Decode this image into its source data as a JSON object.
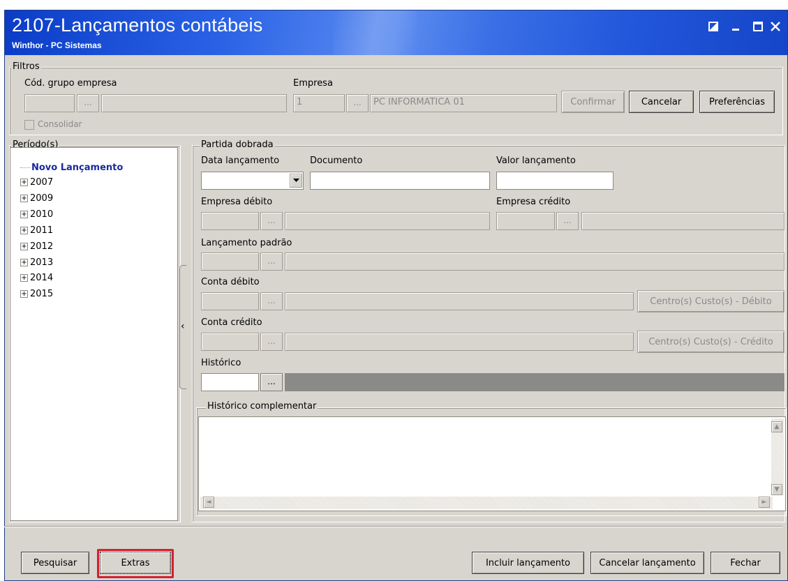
{
  "window": {
    "title": "2107-Lançamentos contábeis",
    "subtitle": "Winthor - PC Sistemas",
    "controls": {
      "restore": "◩",
      "minimize": "–",
      "maximize": "☐",
      "close": "✕"
    }
  },
  "filtros": {
    "title": "Filtros",
    "cod_grupo_label": "Cód. grupo empresa",
    "cod_grupo_value": "",
    "cod_grupo_desc": "",
    "empresa_label": "Empresa",
    "empresa_code": "1",
    "empresa_name": "PC INFORMATICA 01",
    "ellipsis": "...",
    "confirmar": "Confirmar",
    "cancelar": "Cancelar",
    "preferencias": "Preferências",
    "consolidar": "Consolidar"
  },
  "periodos": {
    "title": "Período(s)",
    "items": [
      "Novo Lançamento",
      "2007",
      "2009",
      "2010",
      "2011",
      "2012",
      "2013",
      "2014",
      "2015"
    ],
    "expander": "+"
  },
  "partida": {
    "title": "Partida dobrada",
    "data_label": "Data lançamento",
    "data_value": "",
    "documento_label": "Documento",
    "documento_value": "",
    "valor_label": "Valor lançamento",
    "valor_value": "",
    "empresa_debito_label": "Empresa débito",
    "empresa_credito_label": "Empresa crédito",
    "lancamento_padrao_label": "Lançamento padrão",
    "conta_debito_label": "Conta débito",
    "conta_credito_label": "Conta crédito",
    "historico_label": "Histórico",
    "historico_value": "",
    "centro_debito": "Centro(s) Custo(s) - Débito",
    "centro_credito": "Centro(s) Custo(s) - Crédito",
    "historico_comp_label": "Histórico complementar",
    "historico_comp_value": ""
  },
  "footer": {
    "pesquisar": "Pesquisar",
    "extras": "Extras",
    "incluir": "Incluir lançamento",
    "cancelar_lanc": "Cancelar lançamento",
    "fechar": "Fechar"
  },
  "colors": {
    "title_bar": "#2a62e6",
    "highlight": "#d6202a",
    "tree_selected_text": "#1a2a9a"
  }
}
